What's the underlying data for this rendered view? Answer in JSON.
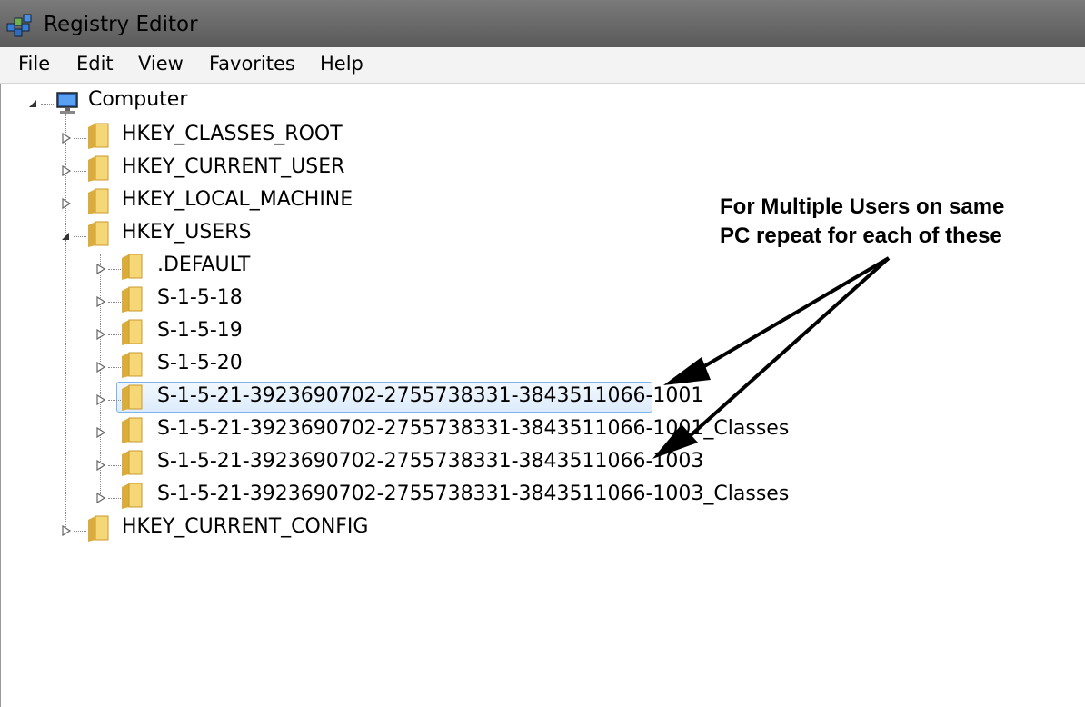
{
  "window": {
    "title": "Registry Editor"
  },
  "menu": [
    "File",
    "Edit",
    "View",
    "Favorites",
    "Help"
  ],
  "tree": {
    "root": "Computer",
    "hives": {
      "classes_root": "HKEY_CLASSES_ROOT",
      "current_user": "HKEY_CURRENT_USER",
      "local_machine": "HKEY_LOCAL_MACHINE",
      "users": "HKEY_USERS",
      "current_config": "HKEY_CURRENT_CONFIG"
    },
    "users_children": [
      ".DEFAULT",
      "S-1-5-18",
      "S-1-5-19",
      "S-1-5-20",
      "S-1-5-21-3923690702-2755738331-3843511066-1001",
      "S-1-5-21-3923690702-2755738331-3843511066-1001_Classes",
      "S-1-5-21-3923690702-2755738331-3843511066-1003",
      "S-1-5-21-3923690702-2755738331-3843511066-1003_Classes"
    ],
    "selected_index": 4
  },
  "annotation": {
    "line1": "For Multiple Users on same",
    "line2": "PC repeat for each of these"
  },
  "icons": {
    "app": "registry-icon",
    "root": "computer-icon",
    "folder": "folder-icon",
    "expanded": "expanded-triangle-icon",
    "collapsed": "collapsed-triangle-icon"
  },
  "colors": {
    "titlebar": "#5a5a5a",
    "selection_border": "#7eb4ea",
    "folder": "#e9c25a"
  }
}
